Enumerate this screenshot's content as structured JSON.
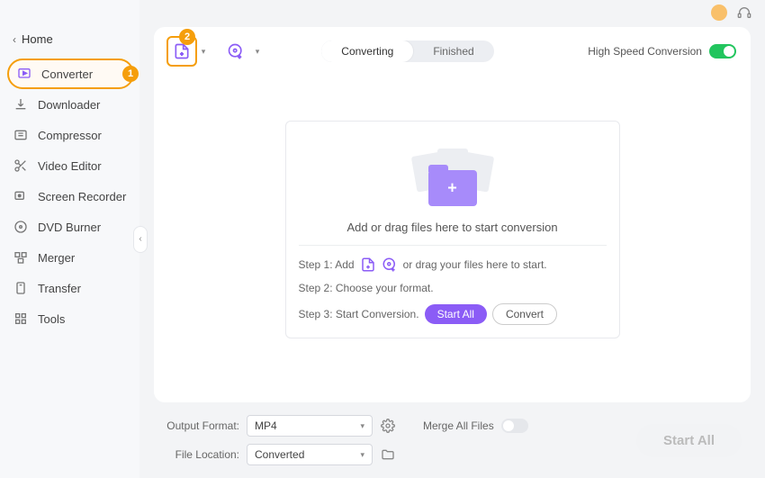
{
  "window": {
    "home_label": "Home"
  },
  "sidebar": {
    "items": [
      {
        "label": "Converter"
      },
      {
        "label": "Downloader"
      },
      {
        "label": "Compressor"
      },
      {
        "label": "Video Editor"
      },
      {
        "label": "Screen Recorder"
      },
      {
        "label": "DVD Burner"
      },
      {
        "label": "Merger"
      },
      {
        "label": "Transfer"
      },
      {
        "label": "Tools"
      }
    ]
  },
  "callouts": {
    "one": "1",
    "two": "2"
  },
  "tabs": {
    "converting": "Converting",
    "finished": "Finished"
  },
  "hsc": {
    "label": "High Speed Conversion"
  },
  "drop": {
    "text": "Add or drag files here to start conversion",
    "step1_a": "Step 1: Add",
    "step1_b": "or drag your files here to start.",
    "step2": "Step 2: Choose your format.",
    "step3": "Step 3: Start Conversion.",
    "start_all": "Start  All",
    "convert": "Convert"
  },
  "footer": {
    "output_label": "Output Format:",
    "output_value": "MP4",
    "location_label": "File Location:",
    "location_value": "Converted",
    "merge_label": "Merge All Files",
    "start_all": "Start All"
  }
}
